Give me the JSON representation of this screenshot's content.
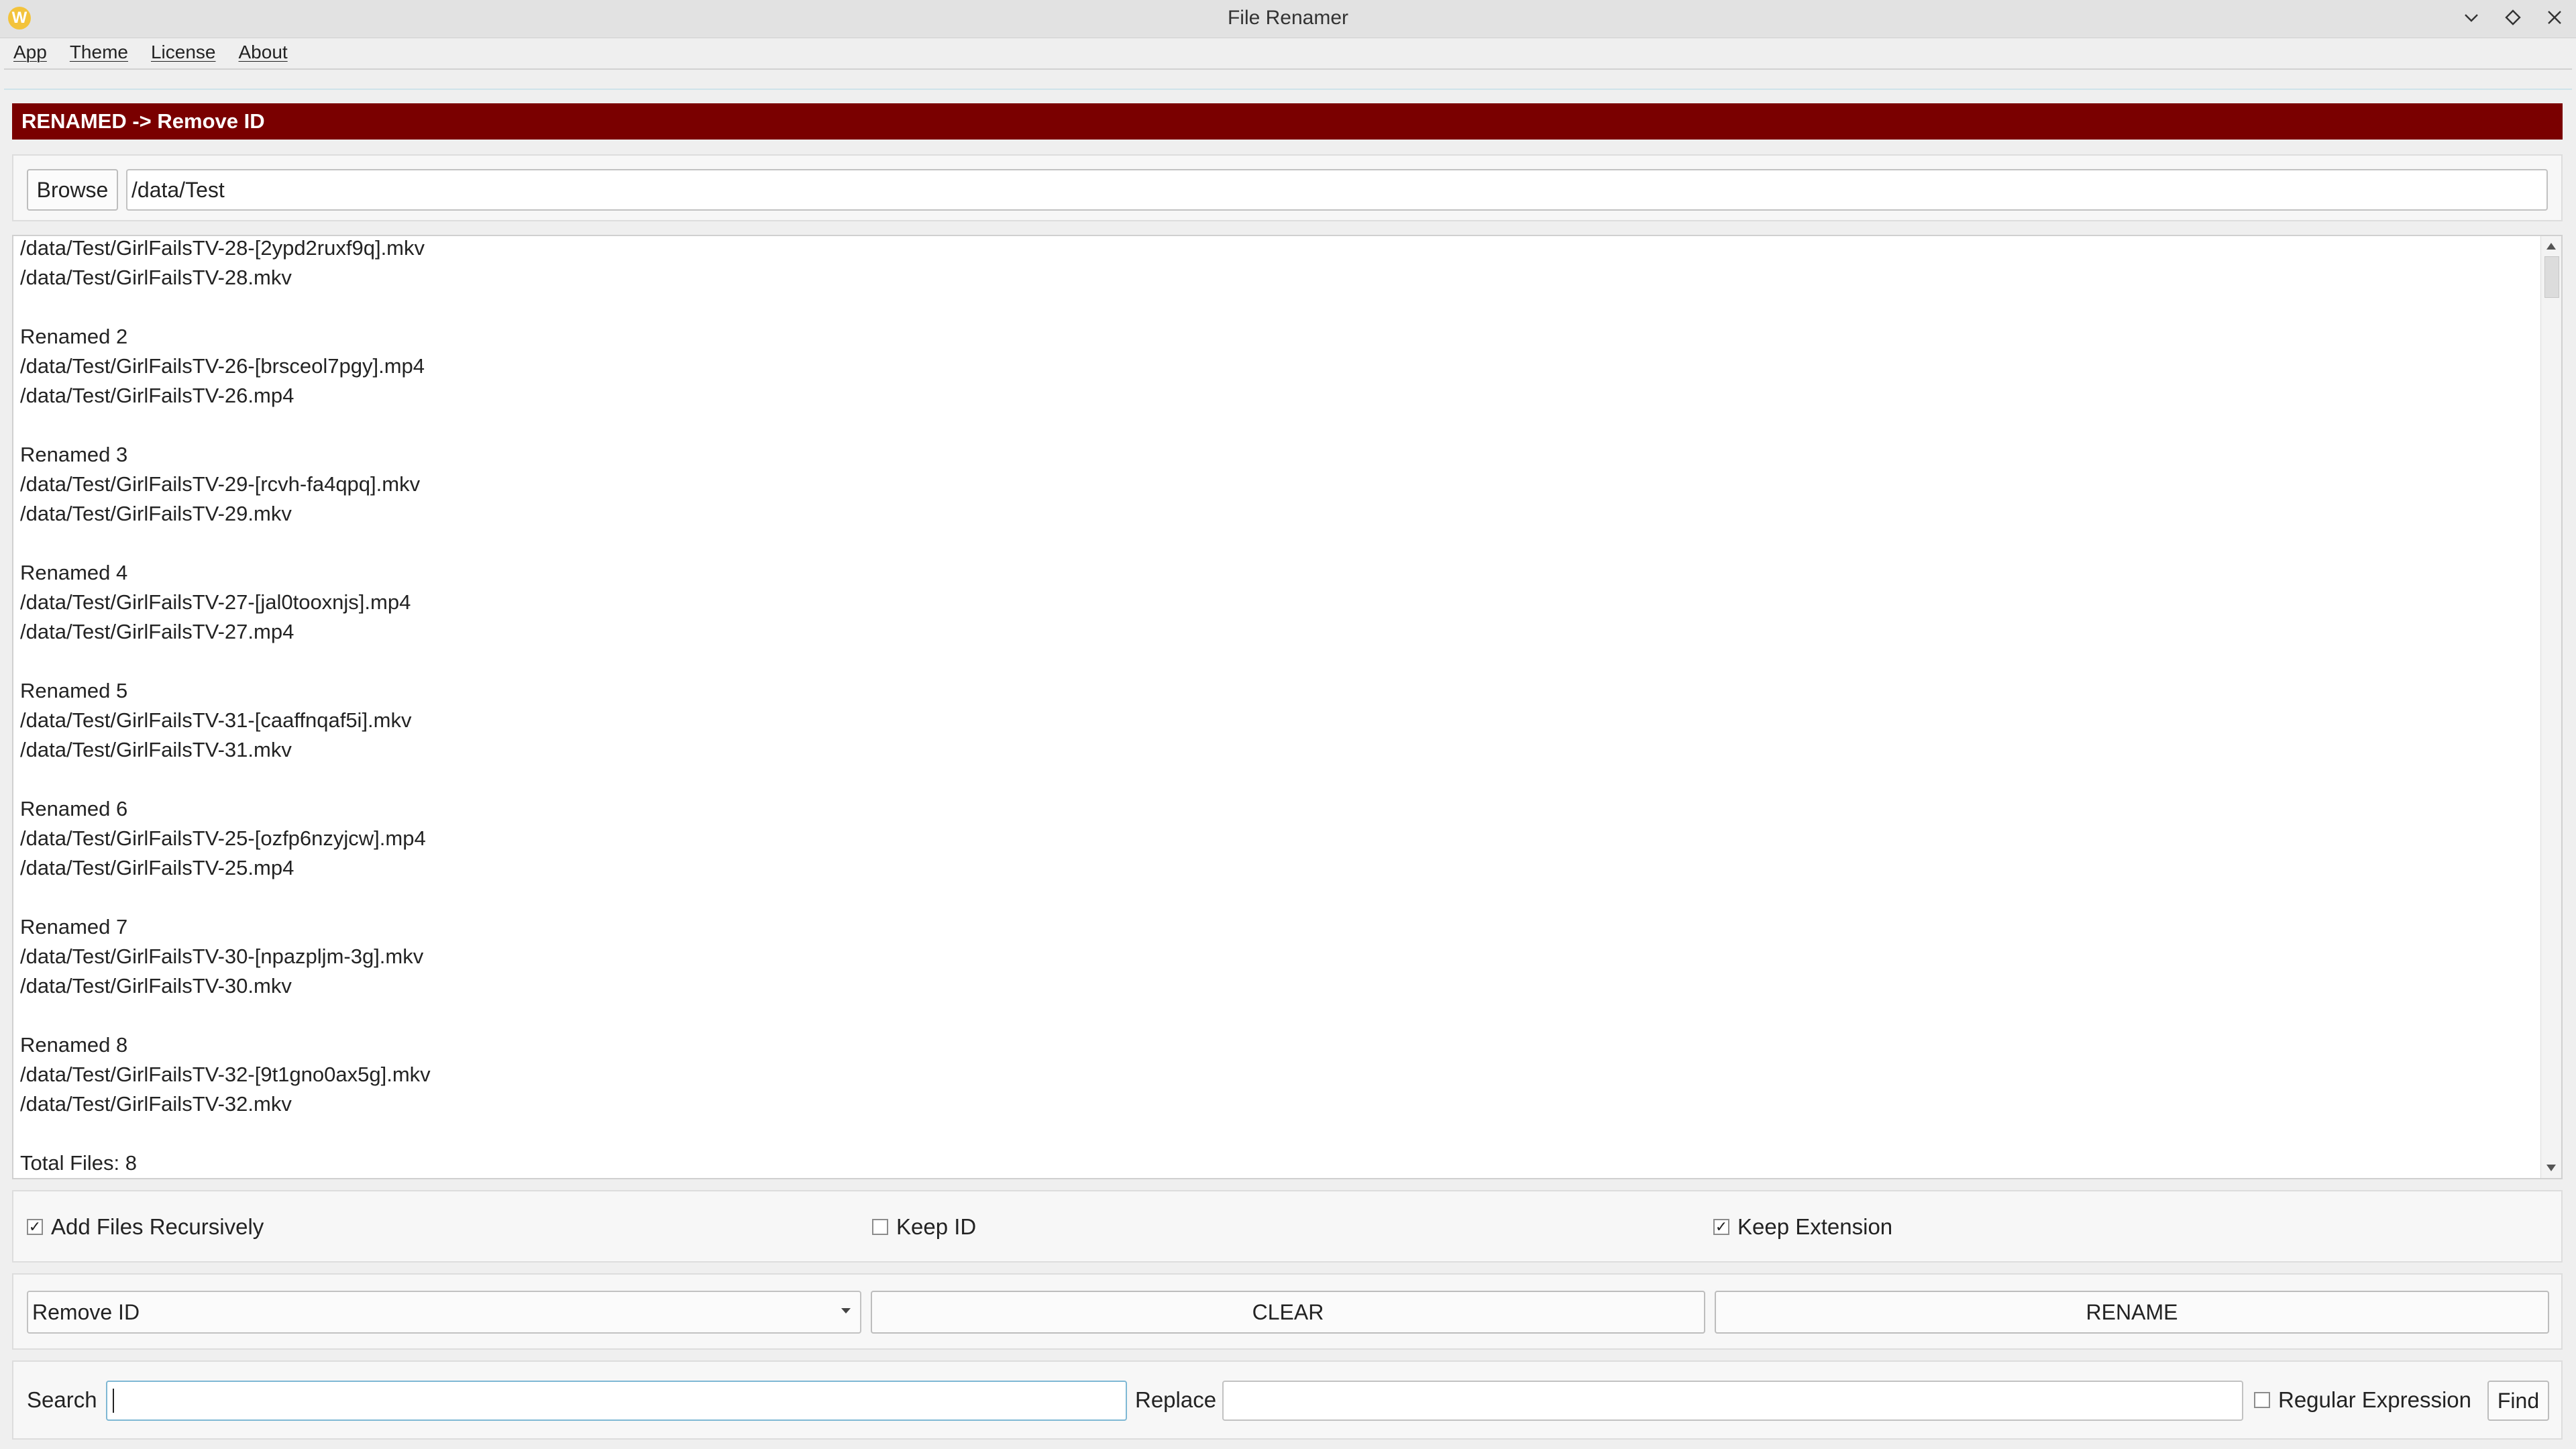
{
  "window": {
    "title": "File Renamer"
  },
  "menu": {
    "items": [
      "App",
      "Theme",
      "License",
      "About"
    ]
  },
  "status": {
    "banner": "RENAMED -> Remove ID",
    "banner_color": "#7a0000"
  },
  "browse": {
    "button_label": "Browse",
    "path_value": "/data/Test"
  },
  "log": {
    "text": "/data/Test/GirlFailsTV-28-[2ypd2ruxf9q].mkv\n/data/Test/GirlFailsTV-28.mkv\n\nRenamed 2\n/data/Test/GirlFailsTV-26-[brsceol7pgy].mp4\n/data/Test/GirlFailsTV-26.mp4\n\nRenamed 3\n/data/Test/GirlFailsTV-29-[rcvh-fa4qpq].mkv\n/data/Test/GirlFailsTV-29.mkv\n\nRenamed 4\n/data/Test/GirlFailsTV-27-[jal0tooxnjs].mp4\n/data/Test/GirlFailsTV-27.mp4\n\nRenamed 5\n/data/Test/GirlFailsTV-31-[caaffnqaf5i].mkv\n/data/Test/GirlFailsTV-31.mkv\n\nRenamed 6\n/data/Test/GirlFailsTV-25-[ozfp6nzyjcw].mp4\n/data/Test/GirlFailsTV-25.mp4\n\nRenamed 7\n/data/Test/GirlFailsTV-30-[npazpljm-3g].mkv\n/data/Test/GirlFailsTV-30.mkv\n\nRenamed 8\n/data/Test/GirlFailsTV-32-[9t1gno0ax5g].mkv\n/data/Test/GirlFailsTV-32.mkv\n\nTotal Files: 8"
  },
  "options": {
    "add_recursive": {
      "label": "Add Files Recursively",
      "checked": true
    },
    "keep_id": {
      "label": "Keep ID",
      "checked": false
    },
    "keep_extension": {
      "label": "Keep Extension",
      "checked": true
    }
  },
  "actions": {
    "mode_selected": "Remove ID",
    "clear_label": "CLEAR",
    "rename_label": "RENAME"
  },
  "search": {
    "search_label": "Search",
    "search_value": "",
    "replace_label": "Replace",
    "replace_value": "",
    "regex_label": "Regular Expression",
    "regex_checked": false,
    "find_label": "Find"
  },
  "icons": {
    "app": "app-logo-icon",
    "minimize": "chevron-down-icon",
    "maximize": "diamond-icon",
    "close": "close-icon"
  }
}
